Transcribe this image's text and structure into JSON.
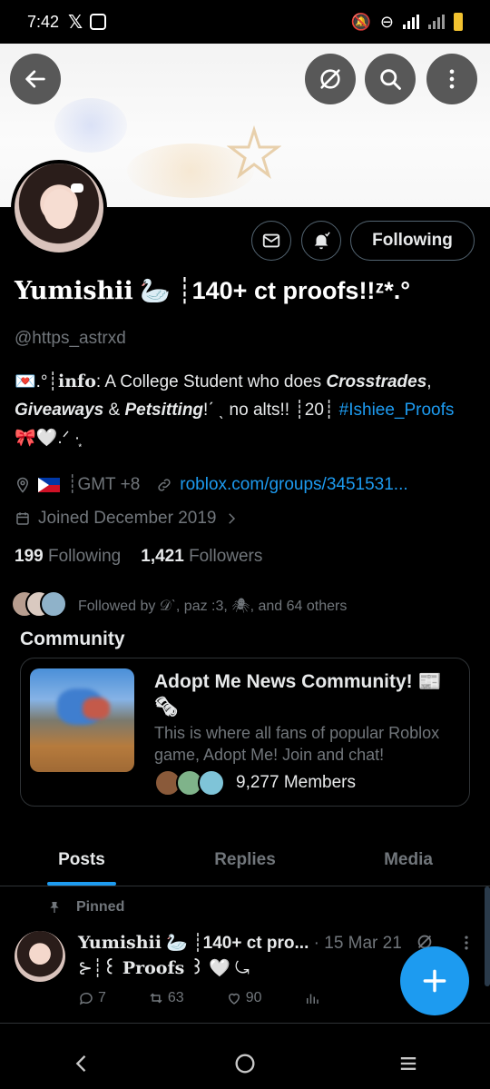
{
  "status_bar": {
    "time": "7:42"
  },
  "header": {
    "back_icon": "arrow-left-icon",
    "grok_icon": "grok-icon",
    "search_icon": "search-icon",
    "more_icon": "more-vertical-icon"
  },
  "profile": {
    "display_name_a": "Yumishii",
    "display_name_b": "🦢 ┊140+ ct proofs!!",
    "display_name_c": "ᶻ*.°",
    "handle": "@https_astrxd",
    "following_button": "Following",
    "bio": {
      "line1_prefix": "💌.°┊",
      "info_label": "info",
      "line1_text": ": A College Student who does ",
      "crosstrades": "Crosstrades",
      "comma": ",",
      "giveaways": "Giveaways",
      "amp": " & ",
      "petsitting": "Petsitting",
      "line2_rest": "!ˊ ˎ no alts!! ┊20┊",
      "hashtag": "#Ishiee_Proofs",
      "line3": "🎀🤍.ᐟ ·͙"
    },
    "location": "GMT +8",
    "website": "roblox.com/groups/3451531...",
    "joined": "Joined December 2019",
    "following_count": "199",
    "following_label": "Following",
    "followers_count": "1,421",
    "followers_label": "Followers",
    "followed_by": "Followed by 𝒟ˋ, paz :3, 🕷, and 64 others"
  },
  "community": {
    "section_title": "Community",
    "name": "Adopt Me News Community! 📰 🗞",
    "description": "This is where all fans of popular Roblox game, Adopt Me! Join and chat!",
    "members": "9,277 Members"
  },
  "tabs": [
    {
      "label": "Posts",
      "active": true
    },
    {
      "label": "Replies",
      "active": false
    },
    {
      "label": "Media",
      "active": false
    }
  ],
  "post": {
    "pinned_label": "Pinned",
    "author_a": "Yumishii",
    "author_b": "🦢 ┊140+ ct pro...",
    "date": "· 15 Mar 21",
    "text_prefix": "⊱┊",
    "text_main": "꒰ Proofs ꒱",
    "text_suffix": "🤍 ⤿",
    "replies": "7",
    "reposts": "63",
    "likes": "90",
    "views": ""
  },
  "colors": {
    "accent": "#1d9bf0",
    "muted": "#71767b",
    "border": "#2f3336"
  }
}
